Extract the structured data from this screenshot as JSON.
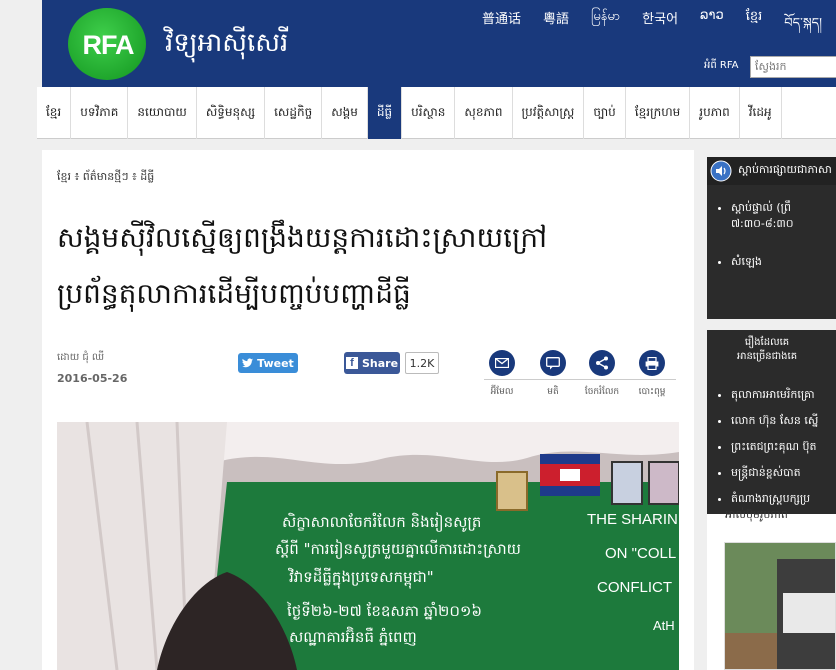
{
  "header": {
    "logo": "RFA",
    "site_title": "វិទ្យុអាស៊ីសេរី",
    "languages": [
      "普通话",
      "粵語",
      "မြန်မာ",
      "한국어",
      "ລາວ",
      "ខ្មែរ",
      "བོད་སྐད།"
    ],
    "about": "អំពី RFA",
    "search_placeholder": "ស្វែងរក"
  },
  "nav": {
    "items": [
      "ខ្មែរ",
      "បទវិភាគ",
      "នយោបាយ",
      "សិទ្ធិមនុស្ស",
      "សេដ្ឋកិច្ច",
      "សង្គម",
      "ដីធ្លី",
      "បរិស្ថាន",
      "សុខភាព",
      "ប្រវត្តិសាស្ត្រ",
      "ច្បាប់",
      "ខ្មែរក្រហម",
      "រូបភាព",
      "វីដេអូ"
    ],
    "active_index": 6
  },
  "article": {
    "breadcrumb": "ខ្មែរ ៖ ព័ត៌មានថ្មីៗ ៖ ដីធ្លី",
    "headline_line1": "សង្គមស៊ីវិលស្នើឲ្យពង្រឹងយន្តការដោះស្រាយក្រៅ",
    "headline_line2": "ប្រព័ន្ធតុលាការដើម្បីបញ្ចប់បញ្ហាដីធ្លី",
    "byline": "ដោយ ជុំ ឈី",
    "date": "2016-05-26",
    "tweet_label": "Tweet",
    "share_label": "Share",
    "share_count": "1.2K",
    "tools": [
      {
        "label": "អ៊ីមែល",
        "icon": "email-icon"
      },
      {
        "label": "មតិ",
        "icon": "comment-icon"
      },
      {
        "label": "ចែករំលែក",
        "icon": "share-icon"
      },
      {
        "label": "បោះពុម្ព",
        "icon": "print-icon"
      }
    ]
  },
  "photo": {
    "banner_line1": "សិក្ខាសាលាចែករំលែក និងរៀនសូត្រ",
    "banner_line2": "ស្តីពី \"ការរៀនសូត្រមួយគ្នាលើការដោះស្រាយ",
    "banner_line3": "វិវាទដីធ្លីក្នុងប្រទេសកម្ពុជា\"",
    "banner_line4": "ថ្ងៃទី២៦-២៧ ខែឧសភា ឆ្នាំ២០១៦",
    "banner_line5": "សណ្ឋាគារអ៊ិនធឺ ភ្នំពេញ",
    "english_line1": "THE SHARIN",
    "english_line2": "ON \"COLL",
    "english_line3": "CONFLICT",
    "english_line4": "AtH"
  },
  "sidebar": {
    "listen_head": "ស្តាប់ការផ្សាយជាភាសា",
    "listen_items": [
      "ស្តាប់ផ្ទាល់ (ព្រឹ",
      "៧:៣០-៨:៣០",
      "សំឡេង"
    ],
    "popular_head_line1": "រឿងដែលគេ",
    "popular_head_line2": "អានច្រើនជាងគេ",
    "popular_items": [
      "តុលាការអាមេរិកគ្រោ",
      "លោក ហ៊ុន សែន ស្នើ",
      "ព្រះតេជព្រះគុណ ប៊ុត",
      "មន្ត្រីជាន់ខ្ពស់បាត",
      "តំណាងរាស្ត្របក្សប្រ"
    ],
    "gallery_label": "អាល់ប៊ុមរូបភាព"
  },
  "colors": {
    "brand_blue": "#19397c",
    "logo_green": "#1fa62c",
    "banner_green": "#1d7a3c",
    "twitter": "#3a8dd8",
    "facebook": "#3b5898"
  }
}
